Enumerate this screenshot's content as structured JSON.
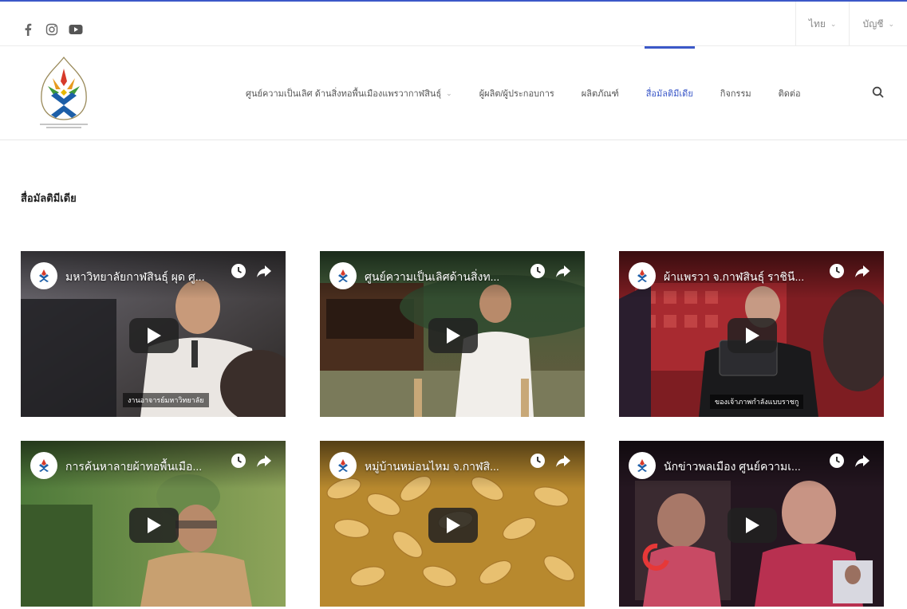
{
  "topbar": {
    "social": [
      {
        "name": "facebook-icon",
        "glyph": "f"
      },
      {
        "name": "instagram-icon",
        "glyph": "instagram"
      },
      {
        "name": "youtube-icon",
        "glyph": "youtube"
      }
    ],
    "language": {
      "label": "ไทย"
    },
    "account": {
      "label": "บัญชี"
    }
  },
  "nav": {
    "items": [
      {
        "label": "ศูนย์ความเป็นเลิศ ด้านสิ่งทอพื้นเมืองแพรวากาฬสินธุ์",
        "has_dropdown": true,
        "active": false
      },
      {
        "label": "ผู้ผลิต/ผู้ประกอบการ",
        "has_dropdown": false,
        "active": false
      },
      {
        "label": "ผลิตภัณฑ์",
        "has_dropdown": false,
        "active": false
      },
      {
        "label": "สื่อมัลติมีเดีย",
        "has_dropdown": false,
        "active": true
      },
      {
        "label": "กิจกรรม",
        "has_dropdown": false,
        "active": false
      },
      {
        "label": "ติดต่อ",
        "has_dropdown": false,
        "active": false
      }
    ]
  },
  "page": {
    "title": "สื่อมัลติมีเดีย"
  },
  "videos": [
    {
      "title": "มหาวิทยาลัยกาฬสินธุ์ ผุด ศู...",
      "caption": "งานอาจารย์มหาวิทยาลัย"
    },
    {
      "title": "ศูนย์ความเป็นเลิศด้านสิ่งท...",
      "caption": ""
    },
    {
      "title": "ผ้าแพรวา จ.กาฬสินธุ์ ราชินี...",
      "caption": "ของเจ้าภาพกำลังแบบราชกู"
    },
    {
      "title": "การค้นหาลายผ้าทอพื้นเมือ...",
      "caption": ""
    },
    {
      "title": "หมู่บ้านหม่อนไหม จ.กาฬสิ...",
      "caption": ""
    },
    {
      "title": "นักข่าวพลเมือง ศูนย์ความเ...",
      "caption": ""
    }
  ],
  "colors": {
    "accent": "#3b58c8",
    "brand_green": "#3e9a3a",
    "brand_blue": "#1d5fa8"
  }
}
